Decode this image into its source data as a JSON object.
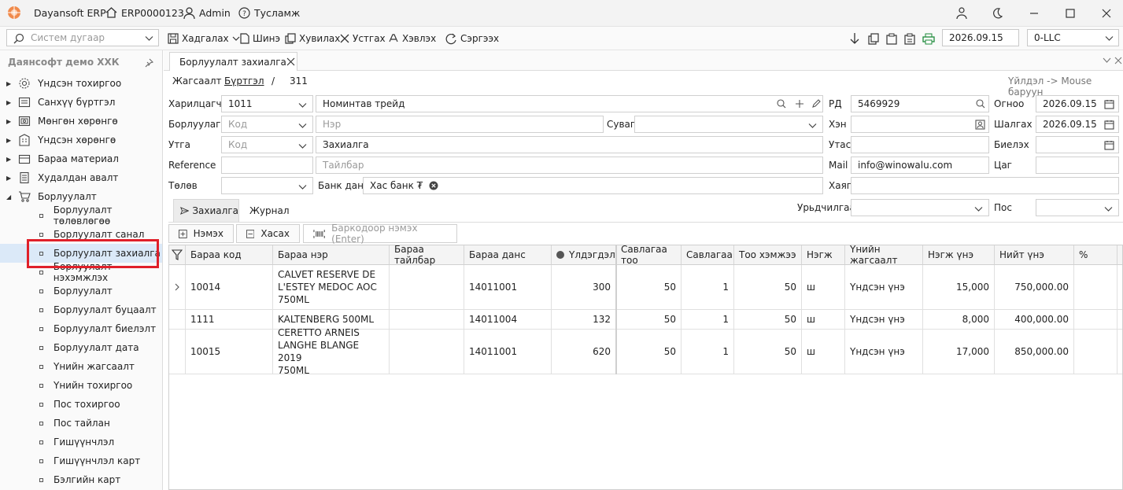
{
  "app": {
    "title": "Dayansoft ERP",
    "code": "ERP0000123",
    "user": "Admin",
    "help": "Тусламж"
  },
  "toolbar": {
    "search_placeholder": "Систем дугаар",
    "save": "Хадгалах",
    "new": "Шинэ",
    "copy": "Хувилах",
    "delete": "Устгах",
    "print": "Хэвлэх",
    "refresh": "Сэргээх",
    "date": "2026.09.15",
    "company": "0-LLC"
  },
  "sidebar": {
    "title": "Даянсофт демо ХХК",
    "items": [
      {
        "label": "Үндсэн тохиргоо",
        "icon": "gear-icon"
      },
      {
        "label": "Санхүү бүртгэл",
        "icon": "ledger-icon"
      },
      {
        "label": "Мөнгөн хөрөнгө",
        "icon": "cash-icon"
      },
      {
        "label": "Үндсэн хөрөнгө",
        "icon": "building-icon"
      },
      {
        "label": "Бараа материал",
        "icon": "box-icon"
      },
      {
        "label": "Худалдан авалт",
        "icon": "purchase-icon"
      },
      {
        "label": "Борлуулалт",
        "icon": "cart-icon"
      }
    ],
    "sub_items": [
      "Борлуулалт төлөвлөгөө",
      "Борлуулалт санал",
      "Борлуулалт захиалга",
      "Борлуулалт нэхэмжлэх",
      "Борлуулалт",
      "Борлуулалт буцаалт",
      "Борлуулалт биелэлт",
      "Борлуулалт дата",
      "Үнийн жагсаалт",
      "Үнийн тохиргоо",
      "Пос тохиргоо",
      "Пос тайлан",
      "Гишүүнчлэл",
      "Гишүүнчлэл карт",
      "Бэлгийн карт"
    ]
  },
  "doc": {
    "tab_title": "Борлуулалт захиалга",
    "crumb_list": "Жагсаалт",
    "crumb_form": "Бүртгэл",
    "crumb_sep": "/",
    "crumb_num": "311",
    "hint": "Үйлдэл -> Mouse баруун"
  },
  "form": {
    "customer_label": "Харилцагч",
    "customer_code": "1011",
    "customer_name": "Номинтав трейд",
    "salesman_label": "Борлуулагч",
    "salesman_code_ph": "Код",
    "salesman_name_ph": "Нэр",
    "channel_label": "Суваг",
    "note_label": "Утга",
    "note_code_ph": "Код",
    "note_value": "Захиалга",
    "reference_label": "Reference",
    "desc_ph": "Тайлбар",
    "payment_label": "Төлөв",
    "bank_label": "Банк данс",
    "bank_value": "Хас банк ₮",
    "rd_label": "РД",
    "rd_value": "5469929",
    "contact_label": "Хэн",
    "phone_label": "Утас",
    "mail_label": "Mail",
    "mail_value": "info@winowalu.com",
    "address_label": "Хаяг",
    "date_label": "Огноо",
    "date_value": "2026.09.15",
    "ship_label": "Шалгах",
    "ship_value": "2026.09.15",
    "fulfil_label": "Биелэх",
    "time_label": "Цаг",
    "priority_label": "Урьдчилгаа",
    "pos_label": "Пос"
  },
  "subtabs": {
    "order": "Захиалга",
    "journal": "Журнал"
  },
  "grid_toolbar": {
    "add": "Нэмэх",
    "remove": "Хасах",
    "barcode_ph": "Баркодоор нэмэх (Enter)"
  },
  "grid": {
    "headers": [
      "Бараа код",
      "Бараа нэр",
      "Бараа тайлбар",
      "Бараа данс",
      "Үлдэгдэл",
      "Савлагаа тоо",
      "Савлагаа",
      "Тоо хэмжээ",
      "Нэгж",
      "Үнийн жагсаалт",
      "Нэгж үнэ",
      "Нийт үнэ",
      "%"
    ],
    "rows": [
      [
        "10014",
        [
          "CALVET RESERVE DE",
          "L'ESTEY MEDOC AOC",
          "750ML"
        ],
        "",
        "14011001",
        "300",
        "50",
        "1",
        "50",
        "ш",
        "Үндсэн үнэ",
        "15,000",
        "750,000.00",
        ""
      ],
      [
        "1111",
        [
          "KALTENBERG 500ML"
        ],
        "",
        "14011004",
        "132",
        "50",
        "1",
        "50",
        "ш",
        "Үндсэн үнэ",
        "8,000",
        "400,000.00",
        ""
      ],
      [
        "10015",
        [
          "CERETTO ARNEIS",
          "LANGHE BLANGE 2019",
          "750ML"
        ],
        "",
        "14011001",
        "620",
        "50",
        "1",
        "50",
        "ш",
        "Үндсэн үнэ",
        "17,000",
        "850,000.00",
        ""
      ]
    ]
  }
}
